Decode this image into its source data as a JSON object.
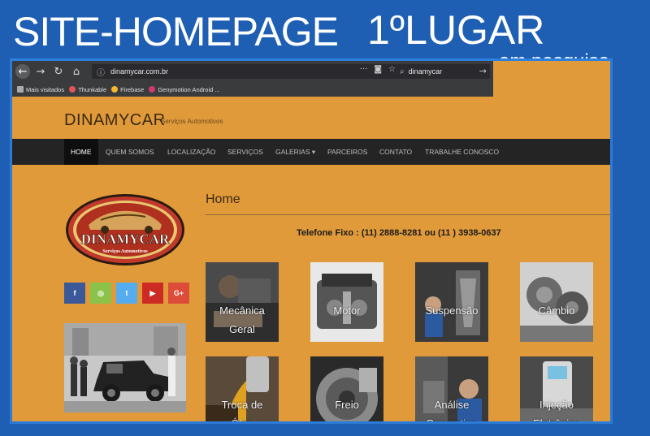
{
  "promo": {
    "title": "SITE-HOMEPAGE",
    "rank": "1ºLUGAR",
    "sub": "em pesquisa"
  },
  "browser": {
    "url": "dinamycar.com.br",
    "search_value": "dinamycar",
    "bookmarks": [
      "Mais visitados",
      "Thunkable",
      "Firebase",
      "Genymotion Android ..."
    ]
  },
  "site": {
    "brand": "DINAMYCAR",
    "brand_sub": "Serviços Automotivos",
    "menu": [
      "HOME",
      "QUEM SOMOS",
      "LOCALIZAÇÃO",
      "SERVIÇOS",
      "GALERIAS ▾",
      "PARCEIROS",
      "CONTATO",
      "TRABALHE CONOSCO"
    ],
    "logo_text": "DINAMYCAR",
    "logo_sub": "Serviços Automotivos",
    "socials": [
      "f",
      "◎",
      "t",
      "▶",
      "G+"
    ],
    "home_heading": "Home",
    "phone": "Telefone Fixo : (11) 2888-8281 ou (11 ) 3938-0637",
    "tiles": [
      {
        "line1": "Mecânica",
        "line2": "Geral"
      },
      {
        "line1": "Motor",
        "line2": ""
      },
      {
        "line1": "Suspensão",
        "line2": ""
      },
      {
        "line1": "Câmbio",
        "line2": ""
      },
      {
        "line1": "Troca de",
        "line2": "Óleo"
      },
      {
        "line1": "",
        "line2": "Freio"
      },
      {
        "line1": "Análise",
        "line2": "Preventiva"
      },
      {
        "line1": "Injeção",
        "line2": "Eletrônica"
      }
    ]
  },
  "colors": {
    "background": "#1e5fb4",
    "site_bg": "#e09a3a",
    "menu_bg": "#242424",
    "facebook": "#3b5998",
    "instagram": "#8bc34a",
    "twitter": "#55acee",
    "youtube": "#cc2a22",
    "googleplus": "#dd4b39"
  }
}
